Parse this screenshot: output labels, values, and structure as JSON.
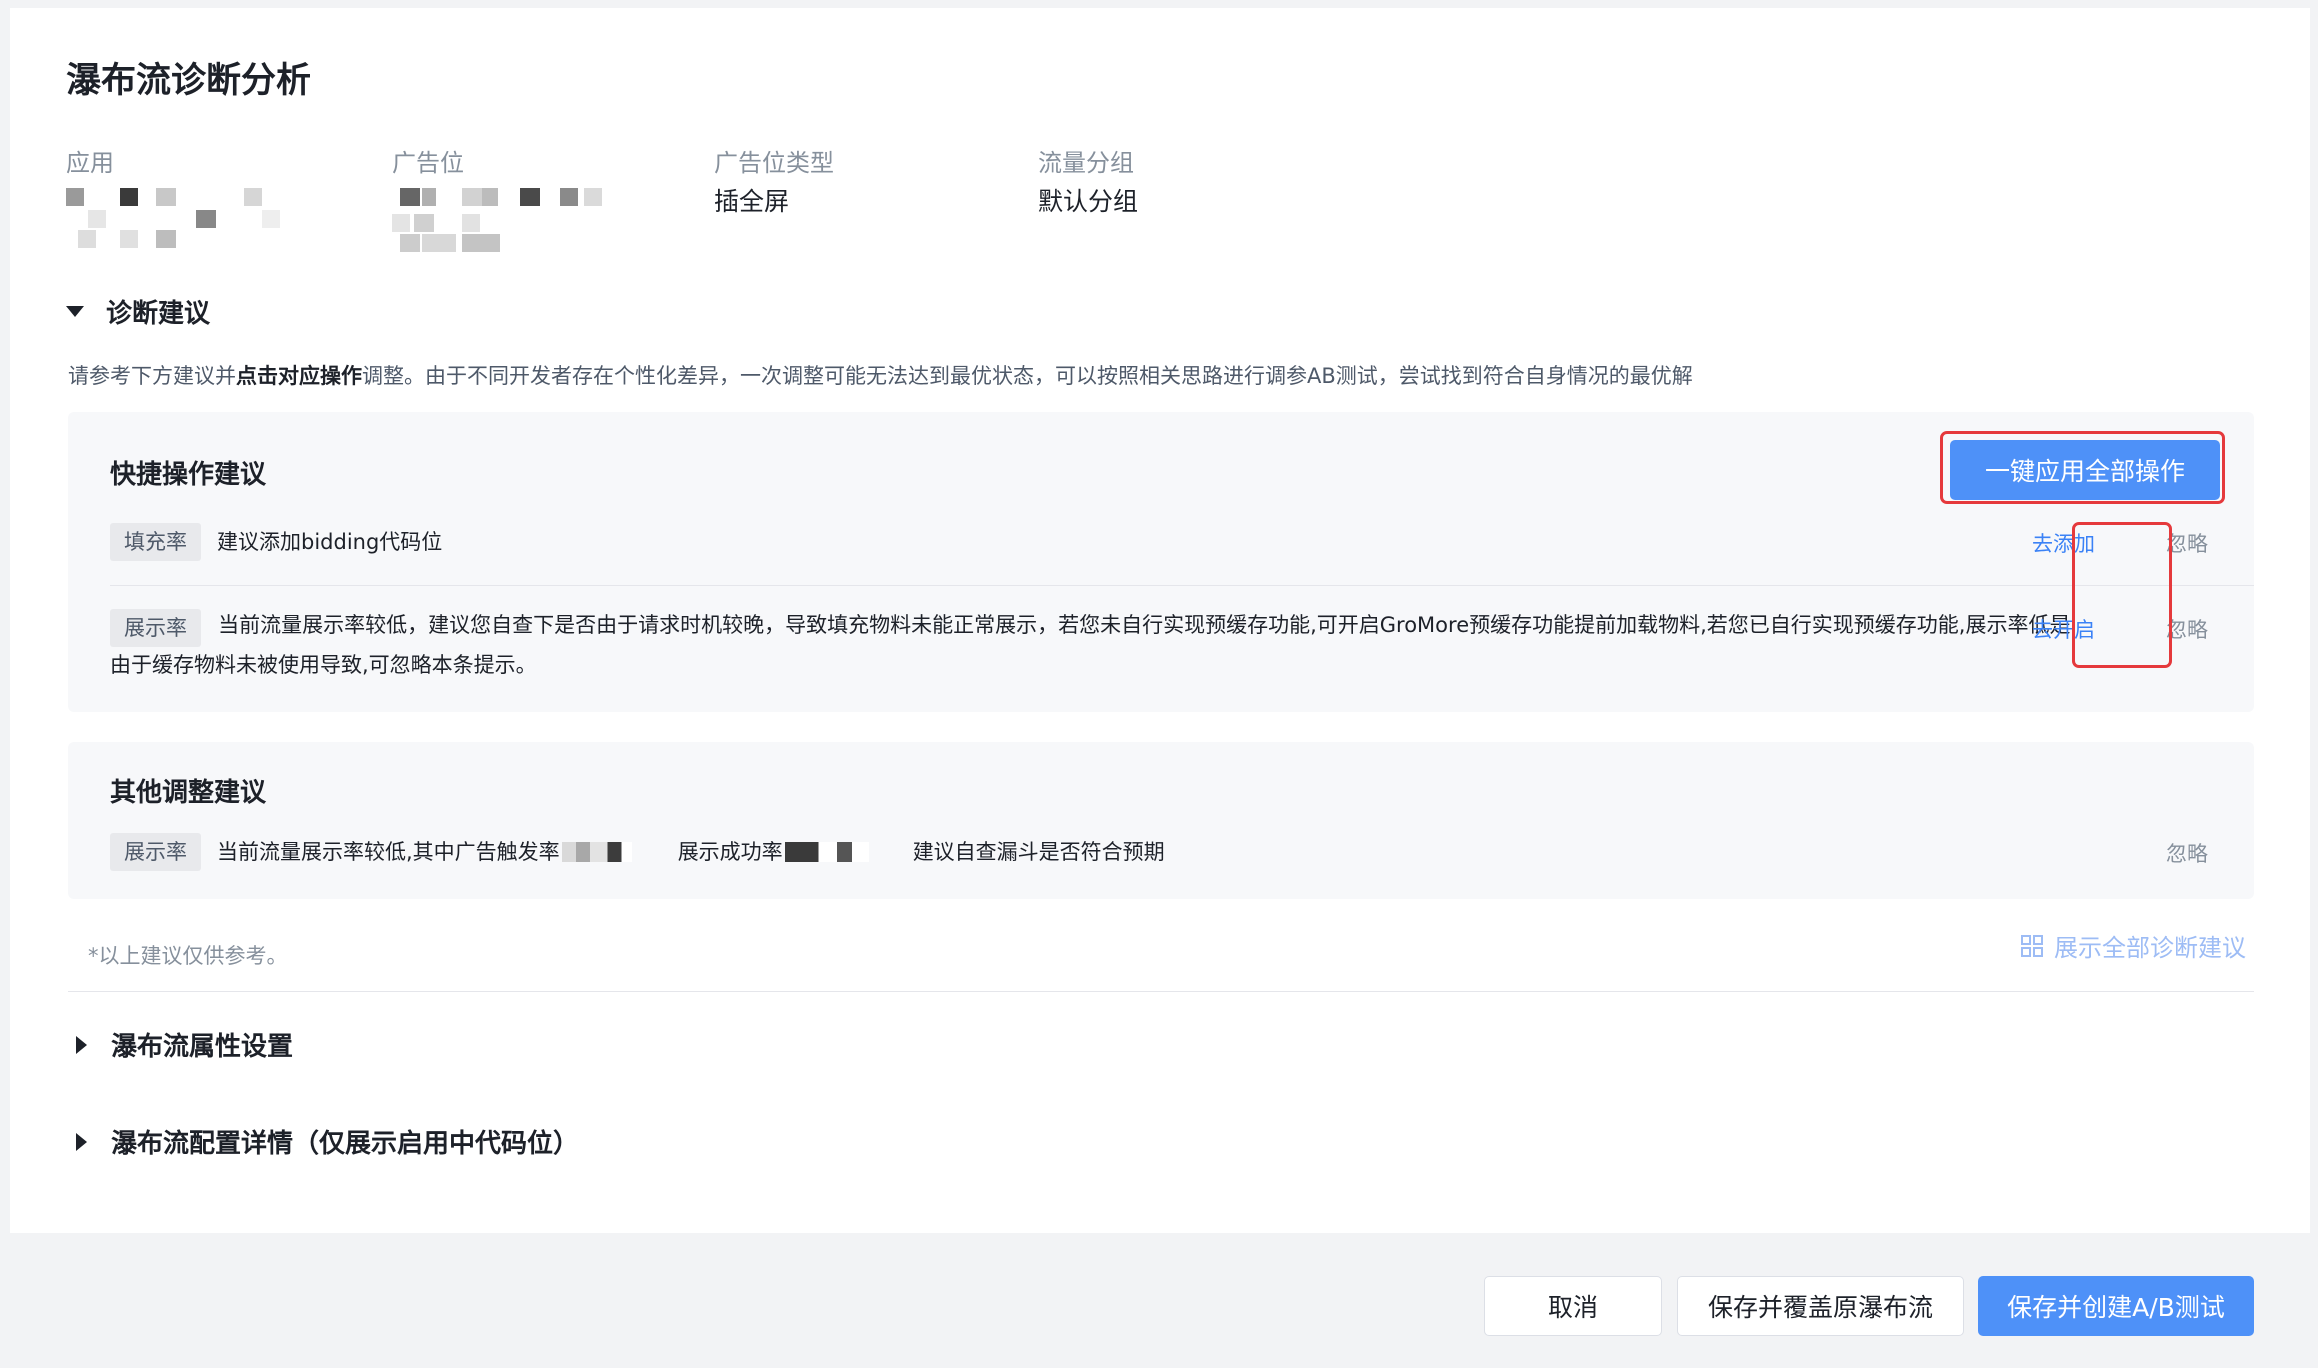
{
  "page": {
    "title": "瀑布流诊断分析"
  },
  "info": {
    "app_label": "应用",
    "ad_slot_label": "广告位",
    "ad_slot_type_label": "广告位类型",
    "ad_slot_type_value": "插全屏",
    "traffic_group_label": "流量分组",
    "traffic_group_value": "默认分组"
  },
  "diagnosis": {
    "title": "诊断建议",
    "desc_prefix": "请参考下方建议并",
    "desc_bold": "点击对应操作",
    "desc_suffix": "调整。由于不同开发者存在个性化差异，一次调整可能无法达到最优状态，可以按照相关思路进行调参AB测试，尝试找到符合自身情况的最优解",
    "quick": {
      "title": "快捷操作建议",
      "apply_all_label": "一键应用全部操作",
      "items": [
        {
          "tag": "填充率",
          "text": "建议添加bidding代码位",
          "action": "去添加",
          "ignore": "忽略"
        },
        {
          "tag": "展示率",
          "text": "当前流量展示率较低，建议您自查下是否由于请求时机较晚，导致填充物料未能正常展示，若您未自行实现预缓存功能,可开启GroMore预缓存功能提前加载物料,若您已自行实现预缓存功能,展示率低是由于缓存物料未被使用导致,可忽略本条提示。",
          "action": "去开启",
          "ignore": "忽略"
        }
      ]
    },
    "other": {
      "title": "其他调整建议",
      "items": [
        {
          "tag": "展示率",
          "text_a": "当前流量展示率较低,其中广告触发率",
          "text_b": "展示成功率",
          "text_c": "建议自查漏斗是否符合预期",
          "ignore": "忽略"
        }
      ]
    },
    "footnote": "*以上建议仅供参考。",
    "show_all_label": "展示全部诊断建议"
  },
  "sections": {
    "waterfall_props": "瀑布流属性设置",
    "waterfall_config": "瀑布流配置详情（仅展示启用中代码位）"
  },
  "footer": {
    "cancel_label": "取消",
    "save_overwrite_label": "保存并覆盖原瀑布流",
    "save_ab_label": "保存并创建A/B测试"
  },
  "colors": {
    "primary": "#4e91f8",
    "link": "#3b82f6",
    "highlight_box": "#e5393c",
    "muted_text": "#86909c"
  }
}
